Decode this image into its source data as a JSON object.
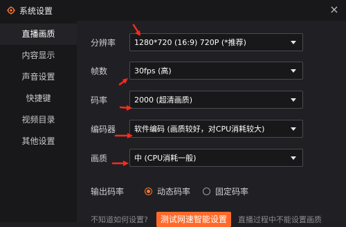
{
  "window": {
    "title": "系统设置",
    "title_icon": "gear-icon",
    "close_icon": "close-icon",
    "close_glyph": "×"
  },
  "sidebar": {
    "items": [
      {
        "label": "直播画质",
        "active": true
      },
      {
        "label": "内容显示",
        "active": false
      },
      {
        "label": "声音设置",
        "active": false
      },
      {
        "label": "快捷键",
        "active": false
      },
      {
        "label": "视频目录",
        "active": false
      },
      {
        "label": "其他设置",
        "active": false
      }
    ]
  },
  "settings": {
    "resolution": {
      "label": "分辨率",
      "value": "1280*720 (16:9) 720P (*推荐)"
    },
    "framerate": {
      "label": "帧数",
      "value": "30fps (高)"
    },
    "bitrate": {
      "label": "码率",
      "value": "2000 (超清画质)"
    },
    "encoder": {
      "label": "编码器",
      "value": "软件编码 (画质较好，对CPU消耗较大)"
    },
    "quality": {
      "label": "画质",
      "value": "中 (CPU消耗一般)"
    },
    "output_rate": {
      "label": "输出码率",
      "options": [
        {
          "label": "动态码率",
          "checked": true
        },
        {
          "label": "固定码率",
          "checked": false
        }
      ]
    }
  },
  "footer": {
    "hint": "不知道如何设置?",
    "speed_test_button": "测试网速智能设置",
    "note": "直播过程中不能设置画质"
  },
  "colors": {
    "accent": "#ff6a2a",
    "annotation_arrow": "#ff2a1a",
    "background": "#202024",
    "sidebar": "#18181b"
  }
}
